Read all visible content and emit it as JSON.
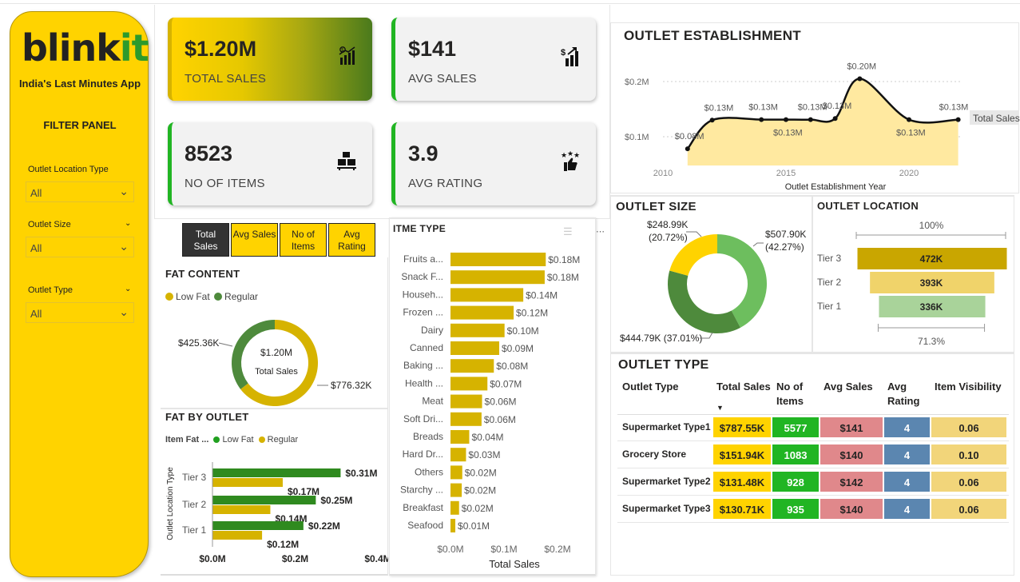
{
  "brand": {
    "logo_main": "blink",
    "logo_accent": "it",
    "tagline": "India's Last Minutes App"
  },
  "filters": {
    "title": "FILTER PANEL",
    "items": [
      {
        "label": "Outlet Location Type",
        "value": "All"
      },
      {
        "label": "Outlet Size",
        "value": "All"
      },
      {
        "label": "Outlet Type",
        "value": "All"
      }
    ]
  },
  "kpis": {
    "total_sales": {
      "value": "$1.20M",
      "label": "TOTAL SALES",
      "icon": "chart-growth-icon"
    },
    "avg_sales": {
      "value": "$141",
      "label": "AVG SALES",
      "icon": "dollar-bars-icon"
    },
    "items": {
      "value": "8523",
      "label": "NO OF ITEMS",
      "icon": "boxes-icon"
    },
    "rating": {
      "value": "3.9",
      "label": "AVG RATING",
      "icon": "stars-thumb-icon"
    }
  },
  "metric_buttons": [
    {
      "label": "Total Sales",
      "active": true
    },
    {
      "label": "Avg Sales",
      "active": false
    },
    {
      "label": "No of Items",
      "active": false
    },
    {
      "label": "Avg Rating",
      "active": false
    }
  ],
  "fat_content": {
    "title": "FAT CONTENT",
    "legend": [
      "Low Fat",
      "Regular"
    ],
    "center_value": "$1.20M",
    "center_label": "Total Sales",
    "slices": [
      {
        "name": "Low Fat",
        "value": 776.32,
        "label": "$776.32K",
        "color": "#D6B300"
      },
      {
        "name": "Regular",
        "value": 425.36,
        "label": "$425.36K",
        "color": "#4E8A3C"
      }
    ]
  },
  "fat_by_outlet": {
    "title": "FAT BY OUTLET",
    "legend_title": "Item Fat ...",
    "legend": [
      "Low Fat",
      "Regular"
    ],
    "ylabel": "Outlet Location Type",
    "categories": [
      "Tier 3",
      "Tier 2",
      "Tier 1"
    ],
    "low_fat": [
      0.31,
      0.25,
      0.22
    ],
    "low_fat_labels": [
      "$0.31M",
      "$0.25M",
      "$0.22M"
    ],
    "regular": [
      0.17,
      0.14,
      0.12
    ],
    "regular_labels": [
      "$0.17M",
      "$0.14M",
      "$0.12M"
    ],
    "x_ticks": [
      "$0.0M",
      "$0.2M",
      "$0.4M"
    ],
    "x_max": 0.4
  },
  "item_type": {
    "title": "ITME TYPE",
    "xlabel": "Total Sales",
    "x_ticks": [
      "$0.0M",
      "$0.1M",
      "$0.2M"
    ],
    "x_max": 0.2,
    "categories": [
      "Fruits a...",
      "Snack F...",
      "Househ...",
      "Frozen ...",
      "Dairy",
      "Canned",
      "Baking ...",
      "Health ...",
      "Meat",
      "Soft Dri...",
      "Breads",
      "Hard Dr...",
      "Others",
      "Starchy ...",
      "Breakfast",
      "Seafood"
    ],
    "values": [
      0.178,
      0.176,
      0.136,
      0.118,
      0.101,
      0.091,
      0.081,
      0.069,
      0.059,
      0.058,
      0.035,
      0.029,
      0.022,
      0.021,
      0.016,
      0.009
    ],
    "labels": [
      "$0.18M",
      "$0.18M",
      "$0.14M",
      "$0.12M",
      "$0.10M",
      "$0.09M",
      "$0.08M",
      "$0.07M",
      "$0.06M",
      "$0.06M",
      "$0.04M",
      "$0.03M",
      "$0.02M",
      "$0.02M",
      "$0.02M",
      "$0.01M"
    ]
  },
  "establishment": {
    "title": "OUTLET ESTABLISHMENT",
    "xlabel": "Outlet Establishment Year",
    "series_name": "Total Sales",
    "x_ticks": [
      "2010",
      "2015",
      "2020"
    ],
    "y_ticks": [
      "$0.1M",
      "$0.2M"
    ],
    "years": [
      2011,
      2012,
      2014,
      2015,
      2016,
      2017,
      2018,
      2020,
      2022
    ],
    "values": [
      0.078,
      0.13,
      0.131,
      0.131,
      0.131,
      0.133,
      0.205,
      0.131,
      0.131
    ],
    "labels": [
      "$0.08M",
      "$0.13M",
      "$0.13M",
      "$0.13M",
      "$0.13M",
      "$0.13M",
      "$0.20M",
      "$0.13M",
      "$0.13M"
    ]
  },
  "outlet_size": {
    "title": "OUTLET SIZE",
    "slices": [
      {
        "value": 507.9,
        "label": "$507.90K",
        "pct": "(42.27%)",
        "color": "#6DBE5E"
      },
      {
        "value": 444.79,
        "label": "$444.79K (37.01%)",
        "pct": "",
        "color": "#4E8A3C"
      },
      {
        "value": 248.99,
        "label": "$248.99K",
        "pct": "(20.72%)",
        "color": "#FFD300"
      }
    ]
  },
  "outlet_location": {
    "title": "OUTLET LOCATION",
    "top_pct": "100%",
    "bottom_pct": "71.3%",
    "tiers": [
      {
        "name": "Tier 3",
        "value": 472,
        "label": "472K",
        "color": "#C9A600"
      },
      {
        "name": "Tier 2",
        "value": 393,
        "label": "393K",
        "color": "#F0D36A"
      },
      {
        "name": "Tier 1",
        "value": 336,
        "label": "336K",
        "color": "#A9D39A"
      }
    ]
  },
  "outlet_type": {
    "title": "OUTLET TYPE",
    "headers": [
      "Outlet Type",
      "Total Sales",
      "No of Items",
      "Avg Sales",
      "Avg Rating",
      "Item Visibility"
    ],
    "rows": [
      {
        "type": "Supermarket Type1",
        "sales": "$787.55K",
        "items": "5577",
        "avg": "$141",
        "rating": "4",
        "vis": "0.06"
      },
      {
        "type": "Grocery Store",
        "sales": "$151.94K",
        "items": "1083",
        "avg": "$140",
        "rating": "4",
        "vis": "0.10"
      },
      {
        "type": "Supermarket Type2",
        "sales": "$131.48K",
        "items": "928",
        "avg": "$142",
        "rating": "4",
        "vis": "0.06"
      },
      {
        "type": "Supermarket Type3",
        "sales": "$130.71K",
        "items": "935",
        "avg": "$140",
        "rating": "4",
        "vis": "0.06"
      }
    ]
  }
}
